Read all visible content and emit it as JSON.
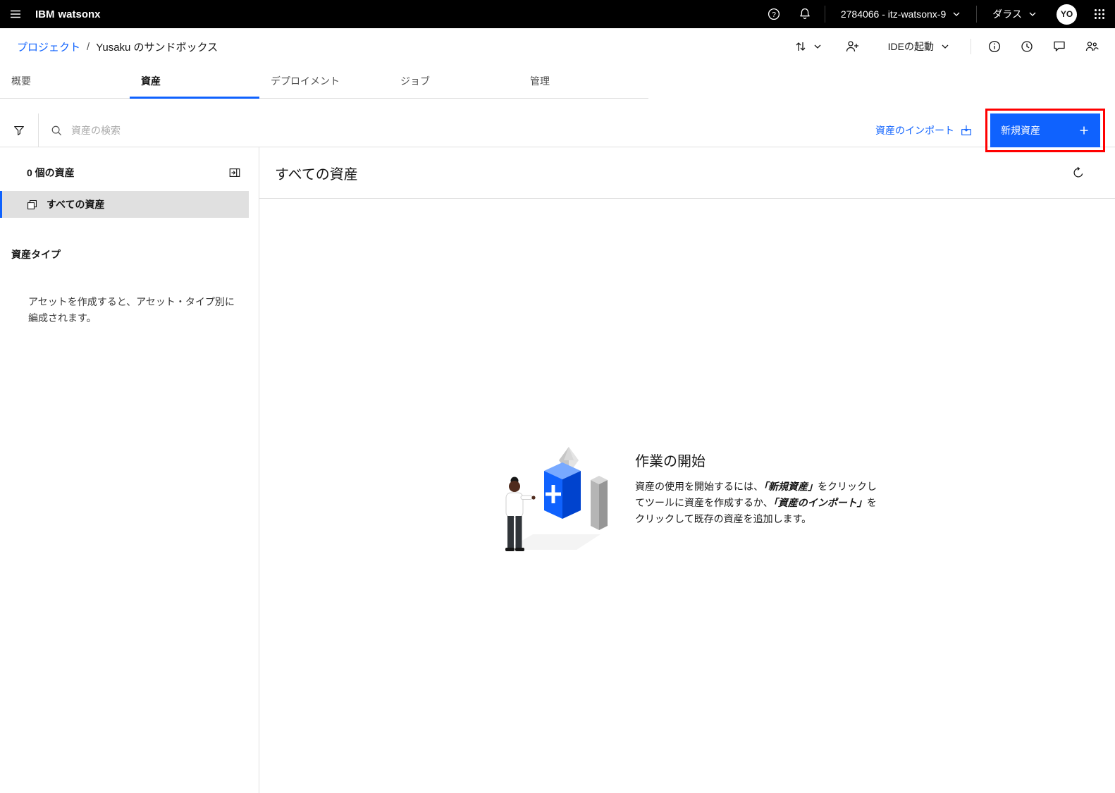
{
  "colors": {
    "accent": "#0f62fe",
    "highlight": "#ff0000"
  },
  "topbar": {
    "brand_prefix": "IBM",
    "brand_name": "watsonx",
    "account": "2784066 - itz-watsonx-9",
    "region": "ダラス",
    "avatar_initials": "YO"
  },
  "breadcrumb": {
    "parent": "プロジェクト",
    "separator": "/",
    "current": "Yusaku のサンドボックス",
    "ide_launch": "IDEの起動"
  },
  "tabs": [
    {
      "label": "概要"
    },
    {
      "label": "資産"
    },
    {
      "label": "デプロイメント"
    },
    {
      "label": "ジョブ"
    },
    {
      "label": "管理"
    }
  ],
  "toolbar": {
    "search_placeholder": "資産の検索",
    "import_label": "資産のインポート",
    "new_asset_label": "新規資産"
  },
  "sidebar": {
    "count": "0 個の資産",
    "all_assets": "すべての資産",
    "type_heading": "資産タイプ",
    "hint": "アセットを作成すると、アセット・タイプ別に編成されます。"
  },
  "main": {
    "title": "すべての資産",
    "empty": {
      "title": "作業の開始",
      "body_1": "資産の使用を開始するには、",
      "body_em_1": "「新規資産」",
      "body_2": "をクリックしてツールに資産を作成するか、",
      "body_em_2": "「資産のインポート」",
      "body_3": "をクリックして既存の資産を追加します。"
    }
  },
  "icons": {
    "hamburger-menu": "≡",
    "help": "?",
    "notifications": "bell",
    "chevron-down": "⌄",
    "app-switcher": "grid-dots",
    "sort-swap": "↑↓",
    "add-user": "person+",
    "info": "ⓘ",
    "recent": "clock",
    "chat": "speech-bubble",
    "collaborators": "people",
    "filter": "funnel",
    "search": "magnifier",
    "import": "tray-arrow",
    "panel-expand": "panel-arrow",
    "all-assets": "stacked-squares",
    "refresh": "circular-arrow",
    "plus": "+"
  }
}
